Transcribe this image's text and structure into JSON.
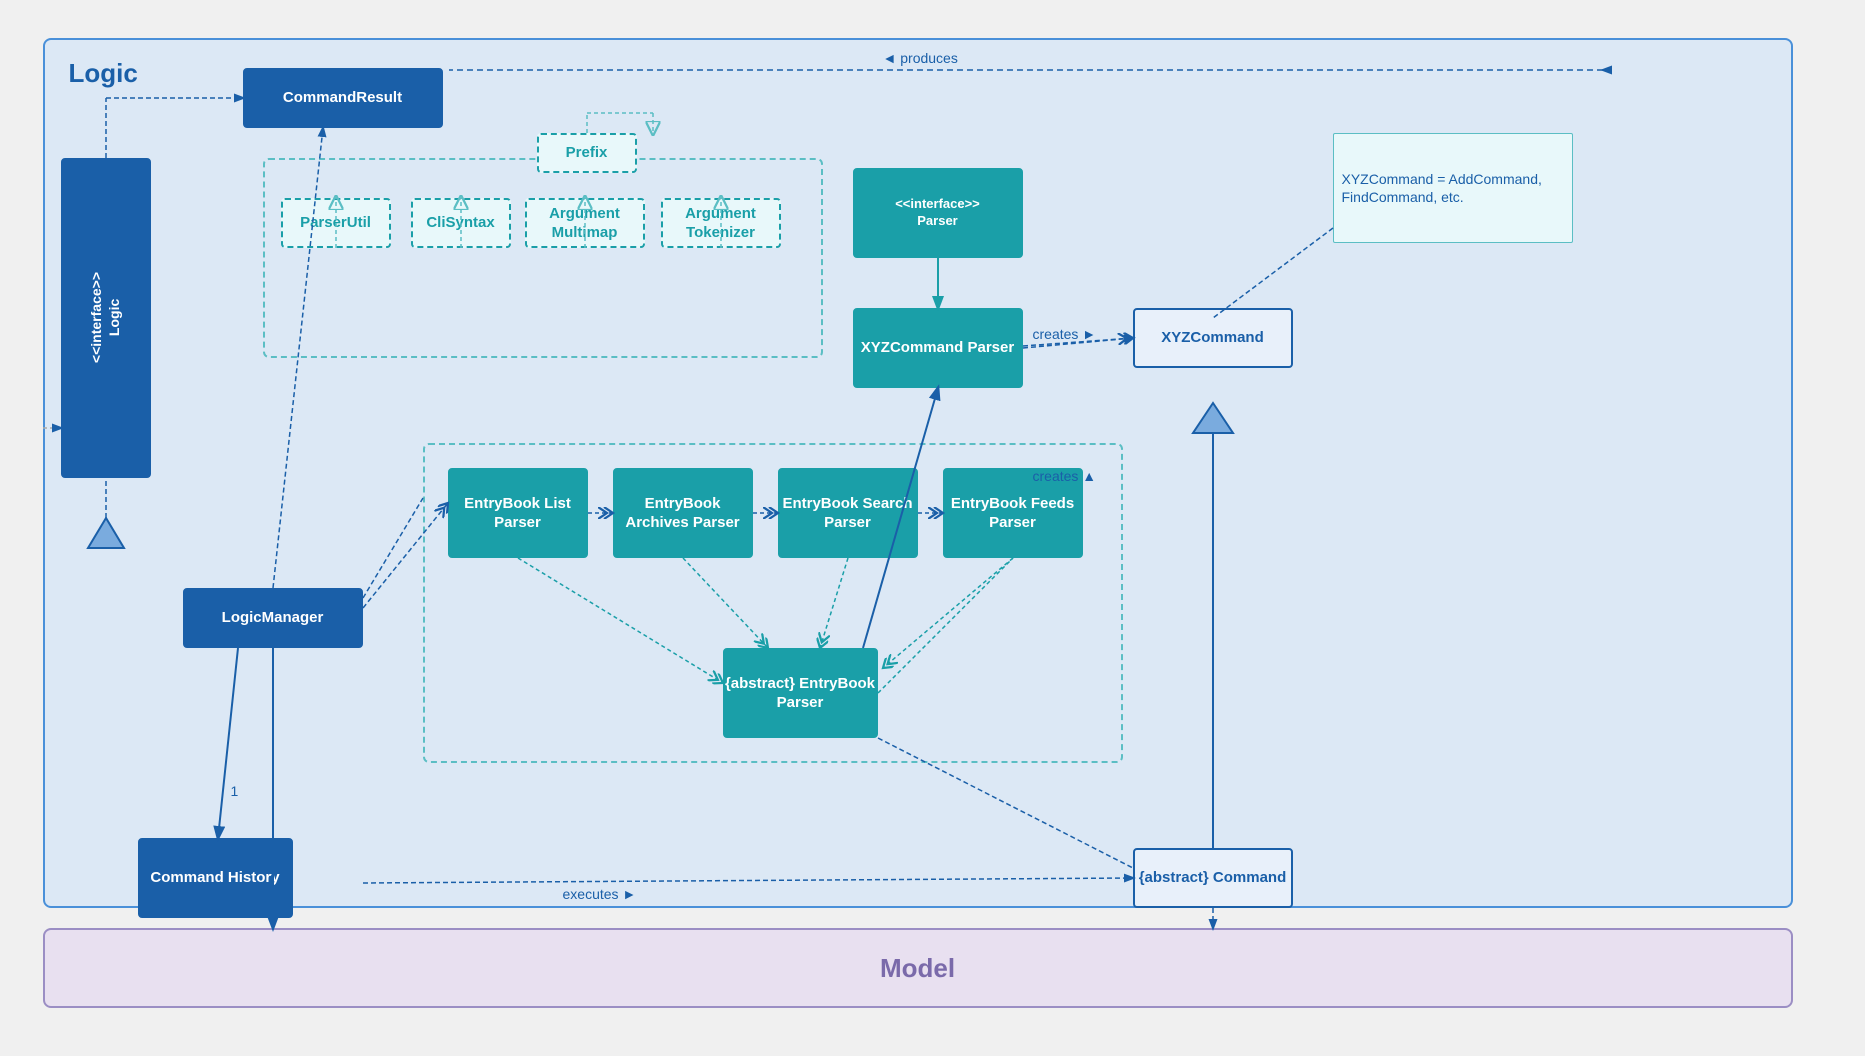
{
  "diagram": {
    "title": "Logic",
    "model_label": "Model",
    "boxes": {
      "command_result": "CommandResult",
      "interface_logic": "<<interface>>\nLogic",
      "logic_manager": "LogicManager",
      "command_history": "Command\nHistory",
      "parser_util": "ParserUtil",
      "cli_syntax": "CliSyntax",
      "argument_multimap": "Argument\nMultimap",
      "argument_tokenizer": "Argument\nTokenizer",
      "prefix": "Prefix",
      "interface_parser": "<<interface>>\nParser",
      "xyz_command_parser": "XYZCommand\nParser",
      "xyz_command": "XYZCommand",
      "entrybook_list_parser": "EntryBook\nList\nParser",
      "entrybook_archives_parser": "EntryBook\nArchives\nParser",
      "entrybook_search_parser": "EntryBook\nSearch\nParser",
      "entrybook_feeds_parser": "EntryBook\nFeeds\nParser",
      "entrybook_parser": "{abstract}\nEntryBook\nParser",
      "abstract_command": "{abstract}\nCommand",
      "note": "XYZCommand =\nAddCommand,\nFindCommand, etc."
    },
    "labels": {
      "produces": "◄ produces",
      "creates_left": "creates ►",
      "creates_right": "creates ►",
      "executes": "executes ►",
      "multiplicity": "1"
    }
  }
}
